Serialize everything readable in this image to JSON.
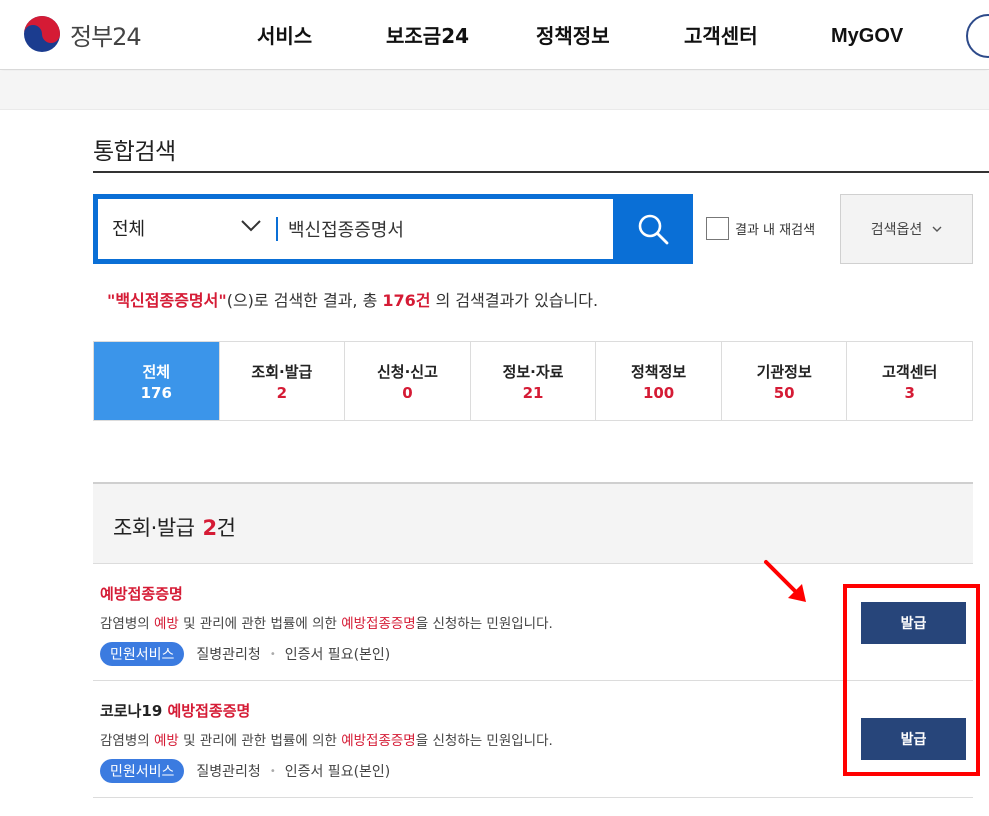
{
  "header": {
    "logo_text": "정부24",
    "nav": [
      "서비스",
      "보조금24",
      "정책정보",
      "고객센터",
      "MyGOV"
    ]
  },
  "page": {
    "title": "통합검색"
  },
  "search": {
    "category": "전체",
    "query": "백신접종증명서",
    "refine_label": "결과 내 재검색",
    "options_label": "검색옵션"
  },
  "summary": {
    "query_quoted": "\"백신접종증명서\"",
    "middle": "(으)로 검색한 결과, 총 ",
    "total": "176건",
    "tail": " 의 검색결과가 있습니다."
  },
  "tabs": [
    {
      "label": "전체",
      "count": "176"
    },
    {
      "label": "조회·발급",
      "count": "2"
    },
    {
      "label": "신청·신고",
      "count": "0"
    },
    {
      "label": "정보·자료",
      "count": "21"
    },
    {
      "label": "정책정보",
      "count": "100"
    },
    {
      "label": "기관정보",
      "count": "50"
    },
    {
      "label": "고객센터",
      "count": "3"
    }
  ],
  "section": {
    "title": "조회·발급",
    "count": "2",
    "unit": "건"
  },
  "results": [
    {
      "title_prefix": "",
      "title_highlight": "예방접종증명",
      "desc_1": "감염병의 ",
      "desc_hl_1": "예방",
      "desc_2": " 및 관리에 관한 법률에 의한 ",
      "desc_hl_2": "예방접종증명",
      "desc_3": "을 신청하는 민원입니다.",
      "badge": "민원서비스",
      "agency": "질병관리청",
      "auth": "인증서 필요(본인)",
      "button": "발급"
    },
    {
      "title_prefix": "코로나19 ",
      "title_highlight": "예방접종증명",
      "desc_1": "감염병의 ",
      "desc_hl_1": "예방",
      "desc_2": " 및 관리에 관한 법률에 의한 ",
      "desc_hl_2": "예방접종증명",
      "desc_3": "을 신청하는 민원입니다.",
      "badge": "민원서비스",
      "agency": "질병관리청",
      "auth": "인증서 필요(본인)",
      "button": "발급"
    }
  ],
  "colors": {
    "primary_blue": "#0a6fd6",
    "tab_active": "#3b95ea",
    "accent_red": "#d51b35",
    "button_navy": "#27457a",
    "annotation_red": "#ff0000"
  }
}
